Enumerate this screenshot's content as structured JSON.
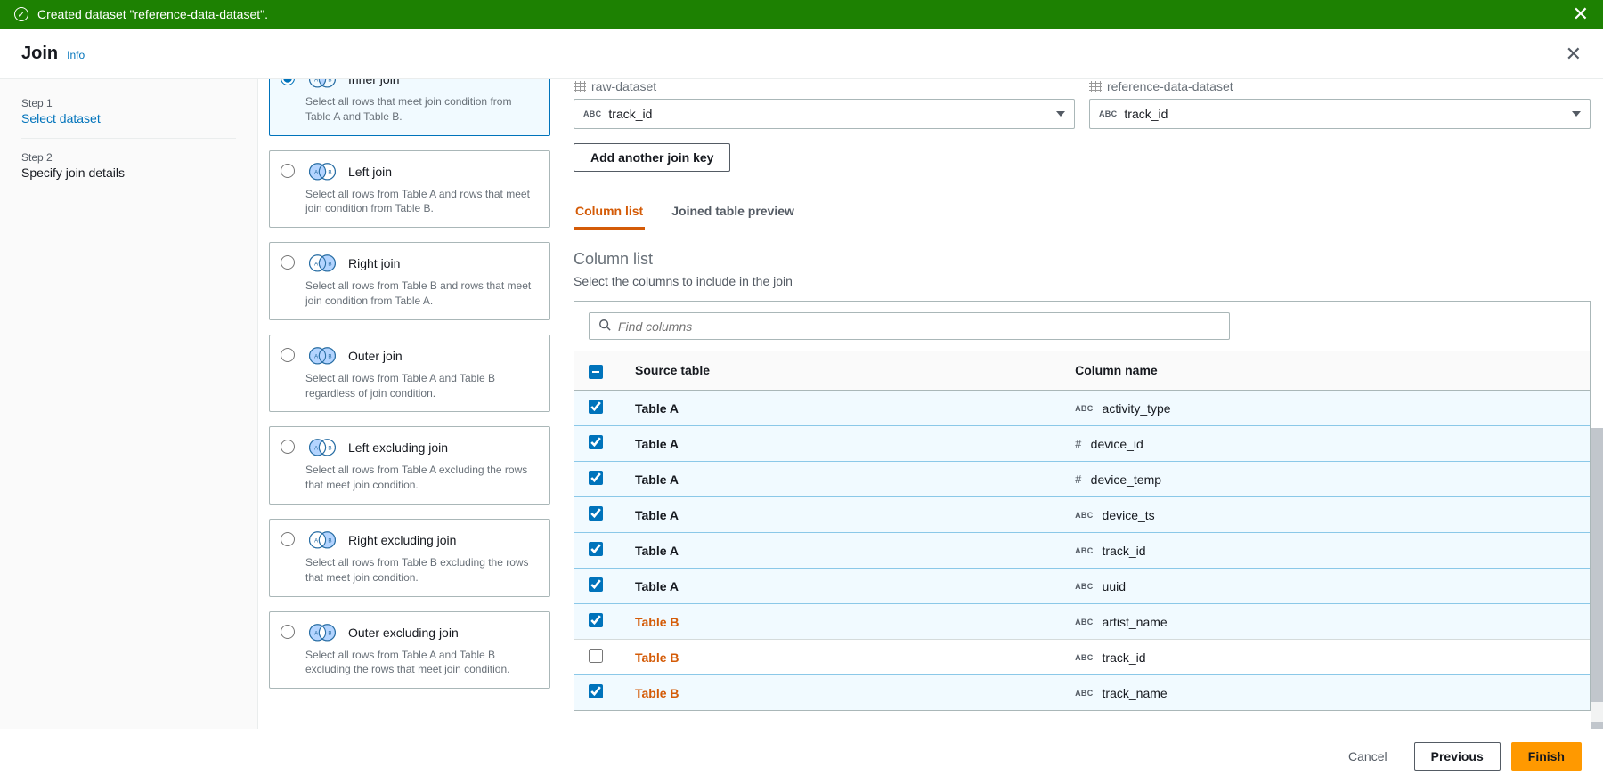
{
  "banner": {
    "message": "Created dataset \"reference-data-dataset\"."
  },
  "page": {
    "title": "Join",
    "info_link": "Info"
  },
  "steps": {
    "s1_num": "Step 1",
    "s1_title": "Select dataset",
    "s2_num": "Step 2",
    "s2_title": "Specify join details"
  },
  "join_types": [
    {
      "label": "Inner join",
      "desc": "Select all rows that meet join condition from Table A and Table B.",
      "selected": true,
      "svg": "inner"
    },
    {
      "label": "Left join",
      "desc": "Select all rows from Table A and rows that meet join condition from Table B.",
      "selected": false,
      "svg": "left"
    },
    {
      "label": "Right join",
      "desc": "Select all rows from Table B and rows that meet join condition from Table A.",
      "selected": false,
      "svg": "right"
    },
    {
      "label": "Outer join",
      "desc": "Select all rows from Table A and Table B regardless of join condition.",
      "selected": false,
      "svg": "outer"
    },
    {
      "label": "Left excluding join",
      "desc": "Select all rows from Table A excluding the rows that meet join condition.",
      "selected": false,
      "svg": "lex"
    },
    {
      "label": "Right excluding join",
      "desc": "Select all rows from Table B excluding the rows that meet join condition.",
      "selected": false,
      "svg": "rex"
    },
    {
      "label": "Outer excluding join",
      "desc": "Select all rows from Table A and Table B excluding the rows that meet join condition.",
      "selected": false,
      "svg": "oex"
    }
  ],
  "datasets": {
    "left": {
      "name": "raw-dataset",
      "key": "track_id",
      "key_type": "ABC"
    },
    "right": {
      "name": "reference-data-dataset",
      "key": "track_id",
      "key_type": "ABC"
    }
  },
  "buttons": {
    "add_key": "Add another join key",
    "cancel": "Cancel",
    "previous": "Previous",
    "finish": "Finish"
  },
  "tabs": {
    "columns": "Column list",
    "preview": "Joined table preview"
  },
  "column_list": {
    "title": "Column list",
    "subtitle": "Select the columns to include in the join",
    "search_placeholder": "Find columns",
    "headers": {
      "source": "Source table",
      "column": "Column name"
    },
    "source_a": "Table A",
    "source_b": "Table B",
    "rows": [
      {
        "source": "A",
        "col": "activity_type",
        "type": "ABC",
        "checked": true
      },
      {
        "source": "A",
        "col": "device_id",
        "type": "#",
        "checked": true
      },
      {
        "source": "A",
        "col": "device_temp",
        "type": "#",
        "checked": true
      },
      {
        "source": "A",
        "col": "device_ts",
        "type": "ABC",
        "checked": true
      },
      {
        "source": "A",
        "col": "track_id",
        "type": "ABC",
        "checked": true
      },
      {
        "source": "A",
        "col": "uuid",
        "type": "ABC",
        "checked": true
      },
      {
        "source": "B",
        "col": "artist_name",
        "type": "ABC",
        "checked": true
      },
      {
        "source": "B",
        "col": "track_id",
        "type": "ABC",
        "checked": false
      },
      {
        "source": "B",
        "col": "track_name",
        "type": "ABC",
        "checked": true
      }
    ]
  }
}
